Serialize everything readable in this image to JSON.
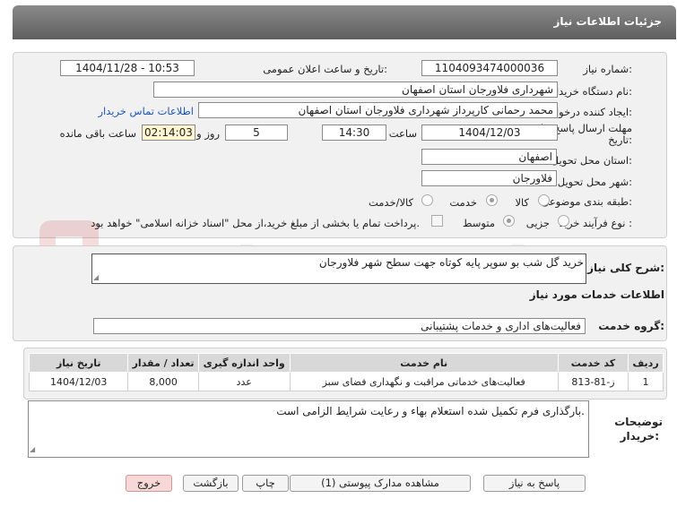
{
  "window": {
    "title": "جزئیات اطلاعات نیاز"
  },
  "form": {
    "need_number_label": "شماره نیاز:",
    "need_number": "1104093474000036",
    "announce_label": "تاریخ و ساعت اعلان عمومی:",
    "announce_value": "1404/11/28 - 10:53",
    "buyer_org_label": "نام دستگاه خریدار:",
    "buyer_org": "شهرداری فلاورجان استان اصفهان",
    "creator_label": "ایجاد کننده درخواست:",
    "creator": "محمد رحمانی کارپرداز شهرداری فلاورجان استان اصفهان",
    "contact_link": "اطلاعات تماس خریدار",
    "deadline_label_1": "مهلت ارسال پاسخ: تا",
    "deadline_label_2": "تاریخ:",
    "deadline_date": "1404/12/03",
    "time_label": "ساعت",
    "deadline_time": "14:30",
    "days_value": "5",
    "days_label": "روز و",
    "remaining_value": "02:14:03",
    "remaining_label": "ساعت باقی مانده",
    "province_label": "استان محل تحویل:",
    "province": "اصفهان",
    "city_label": "شهر محل تحویل:",
    "city": "فلاورجان",
    "category_label": "طبقه بندی موضوعی:",
    "category_options": [
      "کالا",
      "خدمت",
      "کالا/خدمت"
    ],
    "category_selected": "خدمت",
    "process_label": "نوع فرآیند خرید :",
    "process_options": [
      "جزیی",
      "متوسط"
    ],
    "process_selected": "متوسط",
    "payment_note": "پرداخت تمام یا بخشی از مبلغ خرید،از محل \"اسناد خزانه اسلامی\" خواهد بود."
  },
  "description": {
    "label": "شرح کلی نیاز:",
    "value": "خرید گل شب بو سوپر پایه کوتاه جهت سطح شهر فلاورجان"
  },
  "services": {
    "section_title": "اطلاعات خدمات مورد نیاز",
    "group_label": "گروه خدمت:",
    "group_value": "فعالیت‌های اداری و خدمات پشتیبانی",
    "columns": [
      "ردیف",
      "کد خدمت",
      "نام خدمت",
      "واحد اندازه گیری",
      "تعداد / مقدار",
      "تاریخ نیاز"
    ],
    "rows": [
      [
        "1",
        "ز-81-813",
        "فعالیت‌های خدماتی مراقبت و نگهداری فضای سبز",
        "عدد",
        "8,000",
        "1404/12/03"
      ]
    ]
  },
  "buyer_notes": {
    "label_1": "توضیحات",
    "label_2": "خریدار:",
    "value": "بارگذاری فرم تکمیل شده استعلام بهاء و رعایت شرایط الزامی است."
  },
  "buttons": {
    "reply": "پاسخ به نیاز",
    "attachments": "مشاهده مدارک پیوستی (1)",
    "print": "چاپ",
    "back": "بازگشت",
    "exit": "خروج"
  },
  "watermark": {
    "text": "AriaTender.neT"
  },
  "colors": {
    "title_bar": "#6f6f6f",
    "link": "#1a56c8",
    "highlight_field": "#fff5cf",
    "exit_button": "#f8d7d7"
  }
}
